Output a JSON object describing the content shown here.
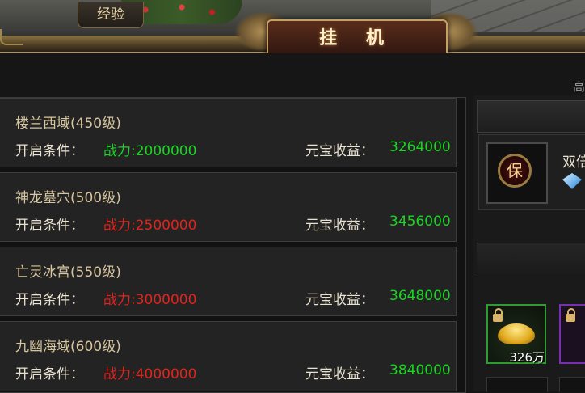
{
  "header": {
    "exp_tab": "经验",
    "title": "挂 机"
  },
  "right_panel": {
    "top_label": "高",
    "bao_icon_text": "保",
    "double_text": "双倍",
    "item_count": "326万"
  },
  "colors": {
    "requirement_met": "#19d621",
    "requirement_not_met": "#e3231c",
    "yield_value": "#19d621"
  },
  "zones": [
    {
      "name": "楼兰西域(450级)",
      "condition_label": "开启条件：",
      "condition_value": "战力:2000000",
      "met": true,
      "yield_label": "元宝收益：",
      "yield_value": "3264000"
    },
    {
      "name": "神龙墓穴(500级)",
      "condition_label": "开启条件：",
      "condition_value": "战力:2500000",
      "met": false,
      "yield_label": "元宝收益：",
      "yield_value": "3456000"
    },
    {
      "name": "亡灵冰宫(550级)",
      "condition_label": "开启条件：",
      "condition_value": "战力:3000000",
      "met": false,
      "yield_label": "元宝收益：",
      "yield_value": "3648000"
    },
    {
      "name": "九幽海域(600级)",
      "condition_label": "开启条件：",
      "condition_value": "战力:4000000",
      "met": false,
      "yield_label": "元宝收益：",
      "yield_value": "3840000"
    }
  ]
}
